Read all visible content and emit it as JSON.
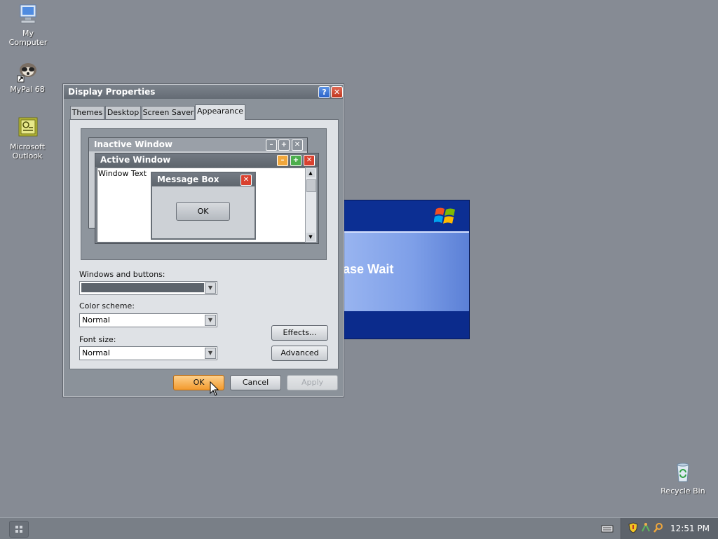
{
  "desktop": {
    "icons": [
      {
        "label_line1": "My",
        "label_line2": "Computer",
        "icon": "computer-icon"
      },
      {
        "label_line1": "MyPal 68",
        "label_line2": "",
        "icon": "raccoon-browser-icon"
      },
      {
        "label_line1": "Microsoft",
        "label_line2": "Outlook",
        "icon": "outlook-icon"
      },
      {
        "label_line1": "Recycle Bin",
        "label_line2": "",
        "icon": "recycle-bin-icon"
      }
    ]
  },
  "splash": {
    "message": "ase Wait",
    "logo": "windows-flag-icon"
  },
  "dialog": {
    "title": "Display Properties",
    "tabs": [
      "Themes",
      "Desktop",
      "Screen Saver",
      "Appearance"
    ],
    "active_tab": "Appearance",
    "preview": {
      "inactive_title": "Inactive Window",
      "active_title": "Active Window",
      "window_text": "Window Text",
      "msgbox_title": "Message Box",
      "msgbox_ok": "OK"
    },
    "windows_buttons_label": "Windows and buttons:",
    "windows_buttons_value": "",
    "color_scheme_label": "Color scheme:",
    "color_scheme_value": "Normal",
    "font_size_label": "Font size:",
    "font_size_value": "Normal",
    "effects_button": "Effects...",
    "advanced_button": "Advanced",
    "ok_button": "OK",
    "cancel_button": "Cancel",
    "apply_button": "Apply"
  },
  "taskbar": {
    "clock": "12:51 PM",
    "tray_icons": [
      "keyboard-icon",
      "security-shield-icon",
      "network-icon",
      "search-icon"
    ]
  },
  "colors": {
    "desktop_bg": "#868b94",
    "ok_button_accent": "#f39a2e",
    "splash_blue": "#0b2d8c"
  }
}
